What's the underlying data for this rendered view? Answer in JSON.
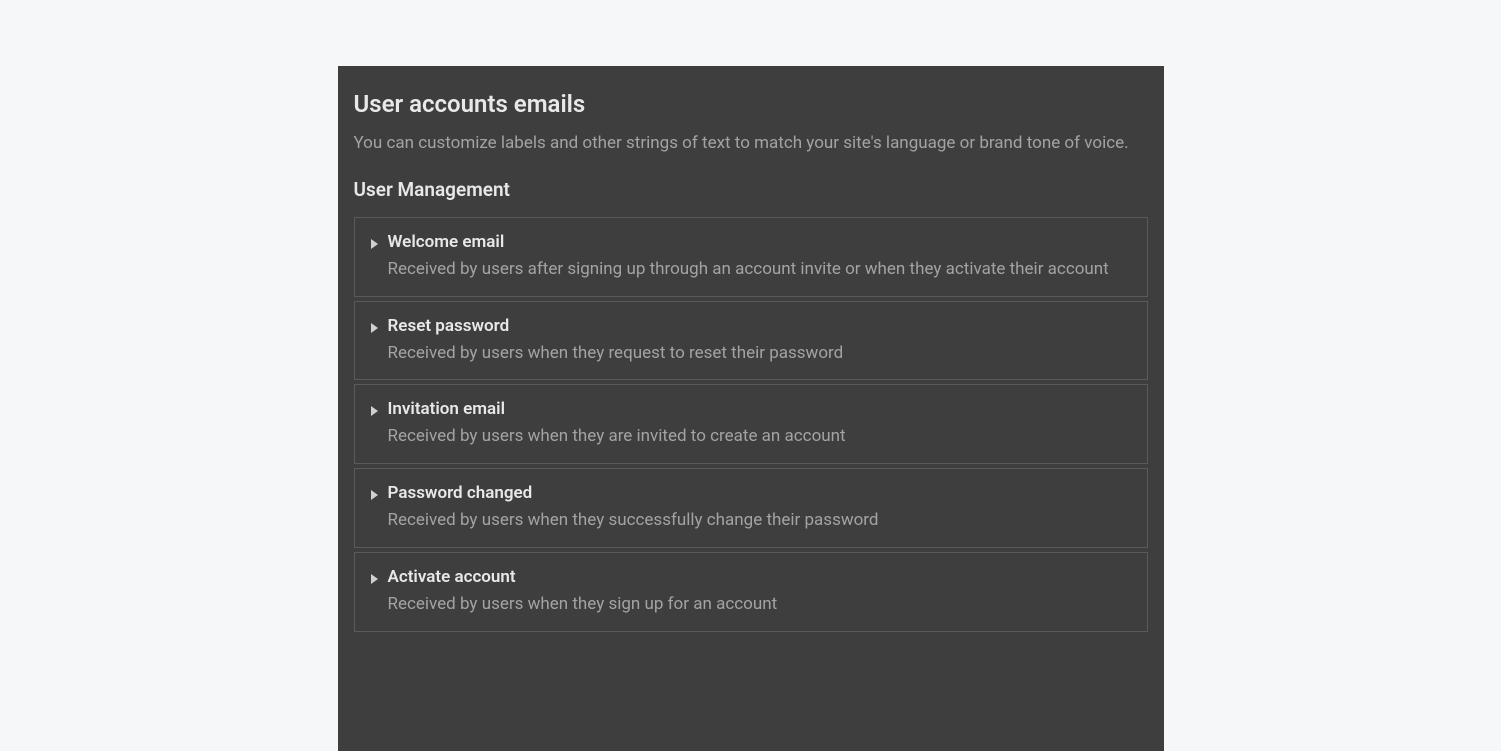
{
  "header": {
    "title": "User accounts emails",
    "description": "You can customize labels and other strings of text to match your site's language or brand tone of voice."
  },
  "section": {
    "title": "User Management",
    "items": [
      {
        "title": "Welcome email",
        "description": "Received by users after signing up through an account invite or when they activate their account"
      },
      {
        "title": "Reset password",
        "description": "Received by users when they request to reset their password"
      },
      {
        "title": "Invitation email",
        "description": "Received by users when they are invited to create an account"
      },
      {
        "title": "Password changed",
        "description": "Received by users when they successfully change their password"
      },
      {
        "title": "Activate account",
        "description": "Received by users when they sign up for an account"
      }
    ]
  }
}
